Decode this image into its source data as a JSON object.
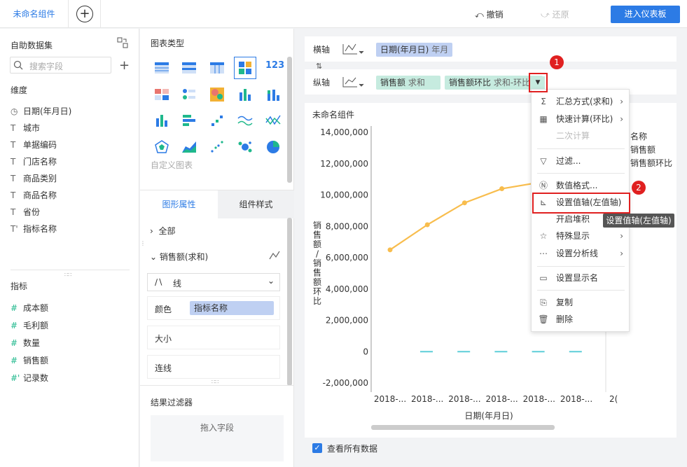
{
  "topbar": {
    "tab_title": "未命名组件",
    "undo_label": "撤销",
    "redo_label": "还原",
    "enter_dashboard_label": "进入仪表板"
  },
  "left": {
    "dataset_title": "自助数据集",
    "search_placeholder": "搜索字段",
    "dimension_title": "维度",
    "dimensions": [
      {
        "icon": "clock-icon",
        "label": "日期(年月日)"
      },
      {
        "icon": "text-icon",
        "label": "城市"
      },
      {
        "icon": "text-icon",
        "label": "单据编码"
      },
      {
        "icon": "text-icon",
        "label": "门店名称"
      },
      {
        "icon": "text-icon",
        "label": "商品类别"
      },
      {
        "icon": "text-icon",
        "label": "商品名称"
      },
      {
        "icon": "text-icon",
        "label": "省份"
      },
      {
        "icon": "text-icon",
        "label": "指标名称"
      }
    ],
    "measure_title": "指标",
    "measures": [
      {
        "icon": "hash-icon",
        "label": "成本额"
      },
      {
        "icon": "hash-icon",
        "label": "毛利额"
      },
      {
        "icon": "hash-icon",
        "label": "数量"
      },
      {
        "icon": "hash-icon",
        "label": "销售额"
      },
      {
        "icon": "hash-icon",
        "label": "记录数"
      }
    ]
  },
  "middle": {
    "chart_type_title": "图表类型",
    "custom_chart_label": "自定义图表",
    "tab_graph_label": "图形属性",
    "tab_component_label": "组件样式",
    "all_label": "全部",
    "series_label": "销售额(求和)",
    "line_type_label": "线",
    "color_label": "颜色",
    "color_field": "指标名称",
    "size_label": "大小",
    "connect_label": "连线",
    "filter_title": "结果过滤器",
    "drop_field_label": "拖入字段"
  },
  "axes": {
    "x_label": "横轴",
    "x_field": "日期(年月日)",
    "x_field_sub": "年月",
    "y_label": "纵轴",
    "y_field_1": "销售额",
    "y_field_1_sub": "求和",
    "y_field_2": "销售额环比",
    "y_field_2_sub": "求和-环比"
  },
  "canvas": {
    "title": "未命名组件",
    "show_all_label": "查看所有数据",
    "legend_title": "名称",
    "legend_items": [
      "销售额",
      "销售额环比"
    ]
  },
  "menu": {
    "items": [
      {
        "label": "汇总方式(求和)",
        "icon": "sigma-icon",
        "arrow": true
      },
      {
        "label": "快速计算(环比)",
        "icon": "calculator-icon",
        "arrow": true
      },
      {
        "label": "二次计算",
        "icon": "",
        "arrow": false,
        "disabled": true
      },
      {
        "label": "过滤...",
        "icon": "filter-icon",
        "arrow": false
      },
      {
        "label": "数值格式...",
        "icon": "number-format-icon",
        "arrow": false
      },
      {
        "label": "设置值轴(左值轴)",
        "icon": "axis-icon",
        "arrow": false
      },
      {
        "label": "开启堆积",
        "icon": "",
        "arrow": false
      },
      {
        "label": "特殊显示",
        "icon": "star-icon",
        "arrow": true
      },
      {
        "label": "设置分析线",
        "icon": "analysis-line-icon",
        "arrow": true
      },
      {
        "label": "设置显示名",
        "icon": "rename-icon",
        "arrow": false
      },
      {
        "label": "复制",
        "icon": "copy-icon",
        "arrow": false
      },
      {
        "label": "删除",
        "icon": "trash-icon",
        "arrow": false
      }
    ],
    "tooltip": "设置值轴(左值轴)"
  },
  "annotations": {
    "marker_1": "1",
    "marker_2": "2"
  },
  "colors": {
    "accent": "#2c7be5",
    "line": "#f8bd4d",
    "bar": "#5ecdd8",
    "annotation": "#e02020"
  },
  "chart_data": {
    "type": "line",
    "xlabel": "日期(年月日)",
    "ylabel": "销售额/销售额环比",
    "x": [
      "2018-...",
      "2018-...",
      "2018-...",
      "2018-...",
      "2018-...",
      "2018-...",
      "2("
    ],
    "y_ticks": [
      "14,000,000",
      "12,000,000",
      "10,000,000",
      "8,000,000",
      "6,000,000",
      "4,000,000",
      "2,000,000",
      "0",
      "-2,000,000"
    ],
    "ylim": [
      -2000000,
      14000000
    ],
    "series": [
      {
        "name": "销售额",
        "type": "line",
        "values": [
          6500000,
          8100000,
          9500000,
          10400000,
          10800000
        ]
      },
      {
        "name": "销售额环比",
        "type": "bar",
        "values": [
          0,
          0,
          0,
          0,
          0
        ]
      }
    ]
  }
}
